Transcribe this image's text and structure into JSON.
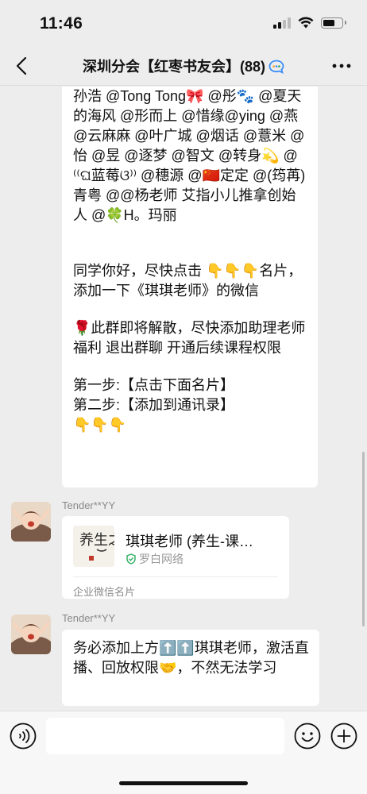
{
  "status_bar": {
    "time": "11:46",
    "battery_level": 0.62
  },
  "nav": {
    "title": "深圳分会【红枣书友会】(88)"
  },
  "messages": {
    "main": {
      "lines": [
        "孙浩 @Tong Tong🎀 @彤🐾 @夏天的海风 @形而上 @惜缘@ying @燕 @云麻麻 @叶广城 @烟话 @薏米 @怡 @昱 @逐梦 @智文 @转身💫 @⁽⁽ଘ蓝莓ଓ⁾⁾ @穗源 @🇨🇳定定 @(筠苒) 青粤 @@杨老师 艾指小儿推拿创始人 @🍀H。玛丽",
        "同学你好，尽快点击 👇👇👇名片，添加一下《琪琪老师》的微信",
        "🌹此群即将解散，尽快添加助理老师福利 退出群聊 开通后续课程权限",
        "第一步:【点击下面名片】\n第二步:【添加到通讯录】\n👇👇👇"
      ]
    },
    "card_message": {
      "sender": "Tender**YY",
      "card_name": "琪琪老师 (养生-课…",
      "card_org": "罗白网络",
      "card_type": "企业微信名片",
      "thumb_text": "养生之道"
    },
    "text_message": {
      "sender": "Tender**YY",
      "text": "务必添加上方⬆️⬆️琪琪老师，激活直播、回放权限🤝，不然无法学习"
    }
  },
  "input_bar": {
    "value": "",
    "placeholder": ""
  },
  "icons": {
    "back": "chevron-left-icon",
    "more": "more-dots-icon",
    "voice": "voice-icon",
    "emoji": "emoji-icon",
    "plus": "plus-icon",
    "verified": "verified-shield-icon"
  },
  "colors": {
    "background": "#ededed",
    "bubble": "#ffffff",
    "verified_green": "#2bad5e",
    "badge_blue": "#3a8ef6"
  }
}
